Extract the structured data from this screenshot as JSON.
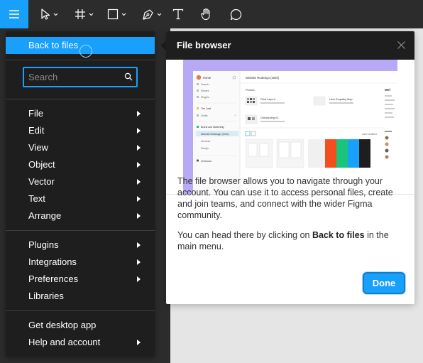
{
  "toolbar": {
    "tools": [
      {
        "icon": "hamburger-menu-icon",
        "active": true
      },
      {
        "icon": "move-tool-icon"
      },
      {
        "icon": "frame-tool-icon"
      },
      {
        "icon": "shape-tool-icon"
      },
      {
        "icon": "pen-tool-icon"
      },
      {
        "icon": "text-tool-icon"
      },
      {
        "icon": "hand-tool-icon"
      },
      {
        "icon": "comment-tool-icon"
      }
    ],
    "accent": "#18a0fb",
    "background": "#2c2c2c"
  },
  "menu": {
    "back_to_files": "Back to files",
    "search_placeholder": "Search",
    "items": [
      "File",
      "Edit",
      "View",
      "Object",
      "Vector",
      "Text",
      "Arrange",
      "Plugins",
      "Integrations",
      "Preferences",
      "Libraries",
      "Get desktop app",
      "Help and account"
    ]
  },
  "tooltip": {
    "title": "File browser",
    "paragraph1": "The file browser allows you to navigate through your account. You can use it to access personal files, create and join teams, and connect with the wider Figma community.",
    "paragraph2_prefix": "You can head there by clicking on ",
    "paragraph2_bold": "Back to files",
    "paragraph2_suffix": " in the main menu.",
    "done_label": "Done"
  },
  "preview": {
    "sidebar": [
      "Home",
      "Search",
      "Recent",
      "Plugins",
      "The Leaf",
      "Drafts",
      "Brand and Marketing",
      "Website Redesign (2020)",
      "Services",
      "Design",
      "Checkout"
    ],
    "header": "Website Redesign (2020)",
    "section": "Pinned",
    "files": [
      "Final Layout",
      "User Empathy Map",
      "Onboarding V1"
    ],
    "right_heading": "Wel",
    "sort_label": "Last modified"
  }
}
